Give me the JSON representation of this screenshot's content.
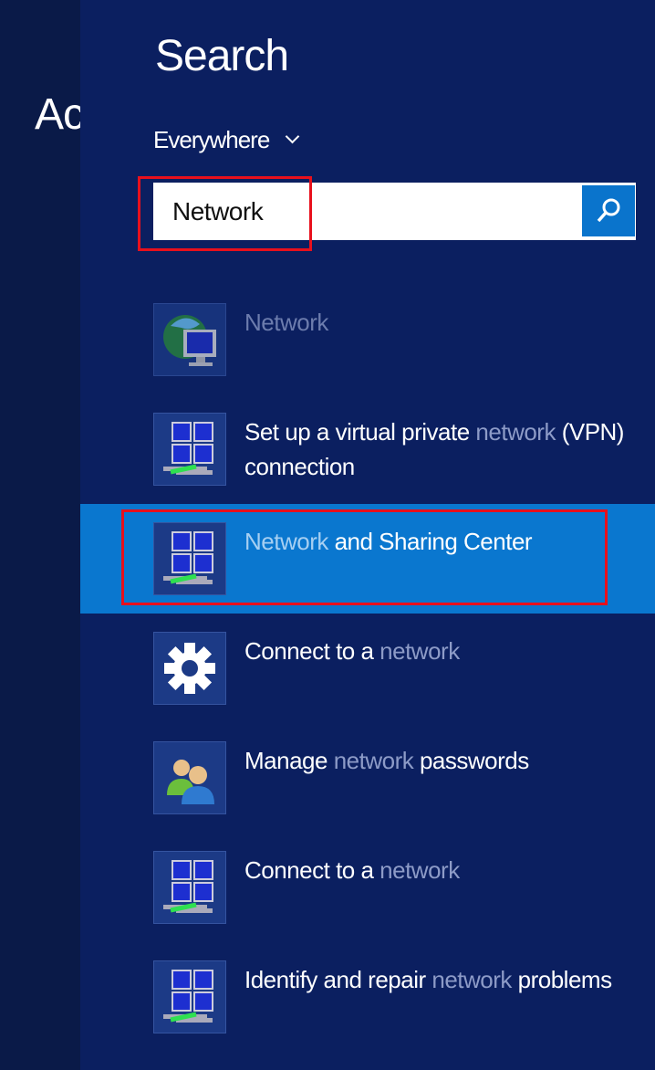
{
  "background": {
    "title_fragment": "Ac"
  },
  "search_pane": {
    "title": "Search",
    "scope": "Everywhere",
    "query": "Network",
    "search_button_icon": "magnifier-icon",
    "results": [
      {
        "icon": "network-globe-icon",
        "segments": [
          {
            "text": "Network",
            "match": false
          }
        ],
        "state": "faded"
      },
      {
        "icon": "network-computers-icon",
        "segments": [
          {
            "text": "Set up a virtual private ",
            "match": false
          },
          {
            "text": "network",
            "match": true
          },
          {
            "text": " (VPN) connection",
            "match": false
          }
        ]
      },
      {
        "icon": "network-computers-icon",
        "segments": [
          {
            "text": "Network",
            "match": true
          },
          {
            "text": " and Sharing Center",
            "match": false
          }
        ],
        "state": "selected"
      },
      {
        "icon": "gear-icon",
        "segments": [
          {
            "text": "Connect to a ",
            "match": false
          },
          {
            "text": "network",
            "match": true
          }
        ]
      },
      {
        "icon": "users-icon",
        "segments": [
          {
            "text": "Manage ",
            "match": false
          },
          {
            "text": "network",
            "match": true
          },
          {
            "text": " passwords",
            "match": false
          }
        ]
      },
      {
        "icon": "network-computers-icon",
        "segments": [
          {
            "text": "Connect to a ",
            "match": false
          },
          {
            "text": "network",
            "match": true
          }
        ]
      },
      {
        "icon": "network-computers-icon",
        "segments": [
          {
            "text": "Identify and repair ",
            "match": false
          },
          {
            "text": "network",
            "match": true
          },
          {
            "text": " problems",
            "match": false
          }
        ]
      }
    ]
  },
  "colors": {
    "panel": "#0b1f60",
    "selected": "#0a77cf",
    "annotation": "#e8101c",
    "search_button": "#0a74cc"
  }
}
